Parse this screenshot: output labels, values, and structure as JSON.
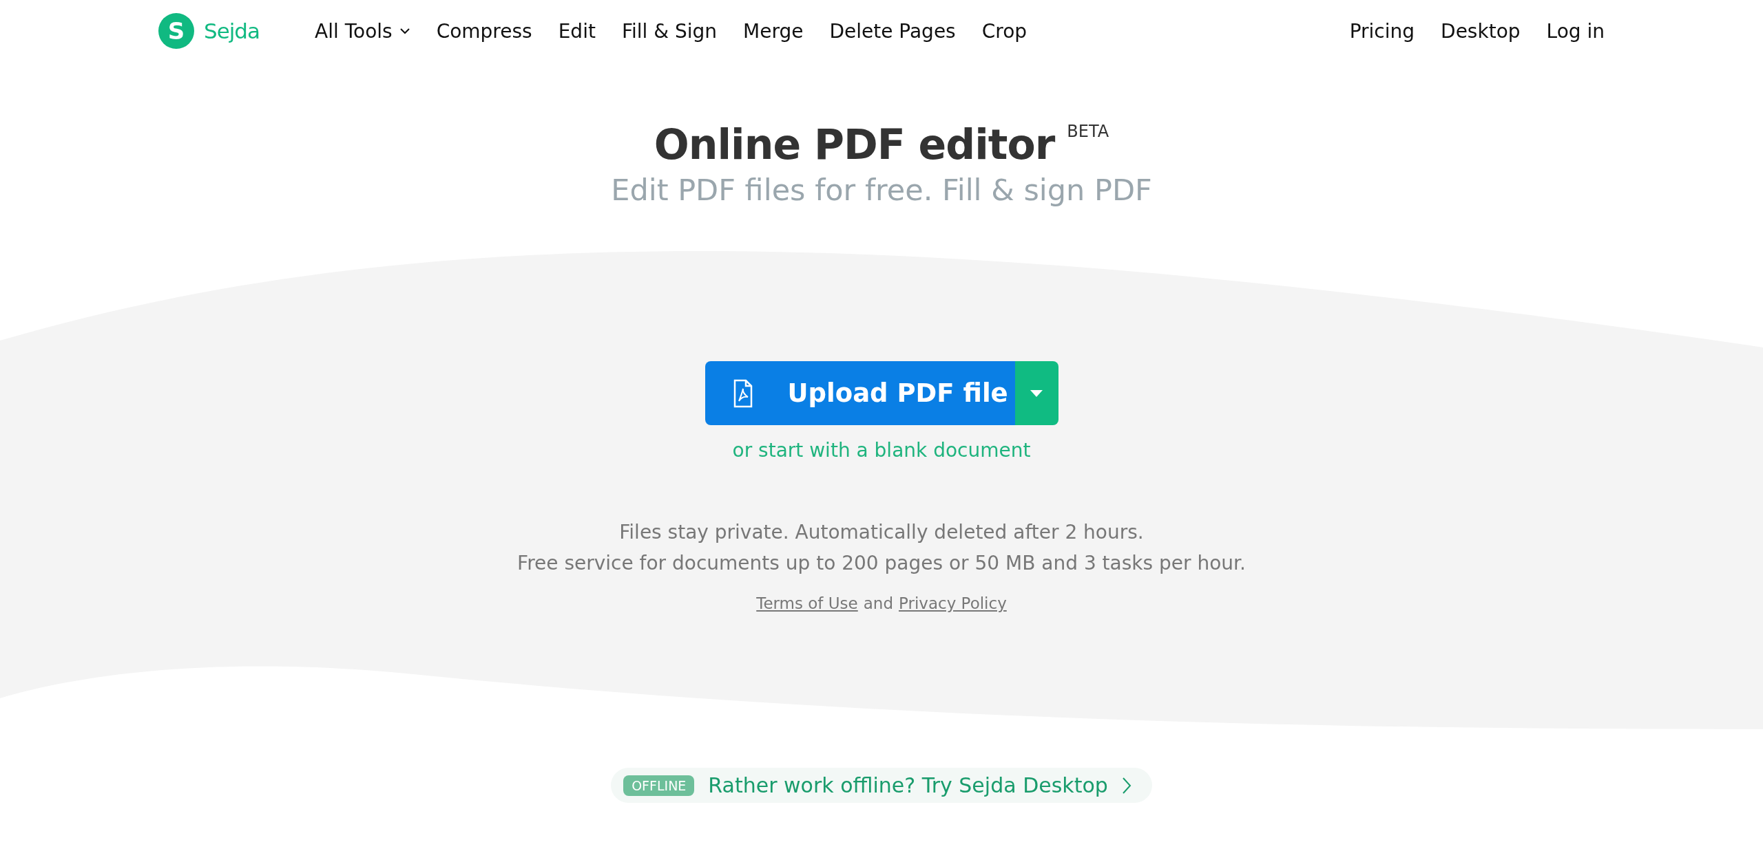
{
  "header": {
    "logo": {
      "letter": "S",
      "name": "Sejda"
    },
    "nav": [
      {
        "label": "All Tools",
        "has_menu": true
      },
      {
        "label": "Compress",
        "has_menu": false
      },
      {
        "label": "Edit",
        "has_menu": false
      },
      {
        "label": "Fill & Sign",
        "has_menu": false
      },
      {
        "label": "Merge",
        "has_menu": false
      },
      {
        "label": "Delete Pages",
        "has_menu": false
      },
      {
        "label": "Crop",
        "has_menu": false
      }
    ],
    "right_links": [
      "Pricing",
      "Desktop",
      "Log in"
    ]
  },
  "hero": {
    "title": "Online PDF editor",
    "badge": "BETA",
    "subtitle": "Edit PDF files for free. Fill & sign PDF"
  },
  "upload": {
    "button": "Upload PDF file",
    "alt_link": "or start with a blank document"
  },
  "info": {
    "lines": [
      "Files stay private. Automatically deleted after 2 hours.",
      "Free service for documents up to 200 pages or 50 MB and 3 tasks per hour."
    ],
    "links": [
      "Terms of Use",
      "Privacy Policy"
    ],
    "joiner": "and"
  },
  "offline": {
    "tag": "OFFLINE",
    "text": "Rather work offline? Try Sejda Desktop"
  }
}
